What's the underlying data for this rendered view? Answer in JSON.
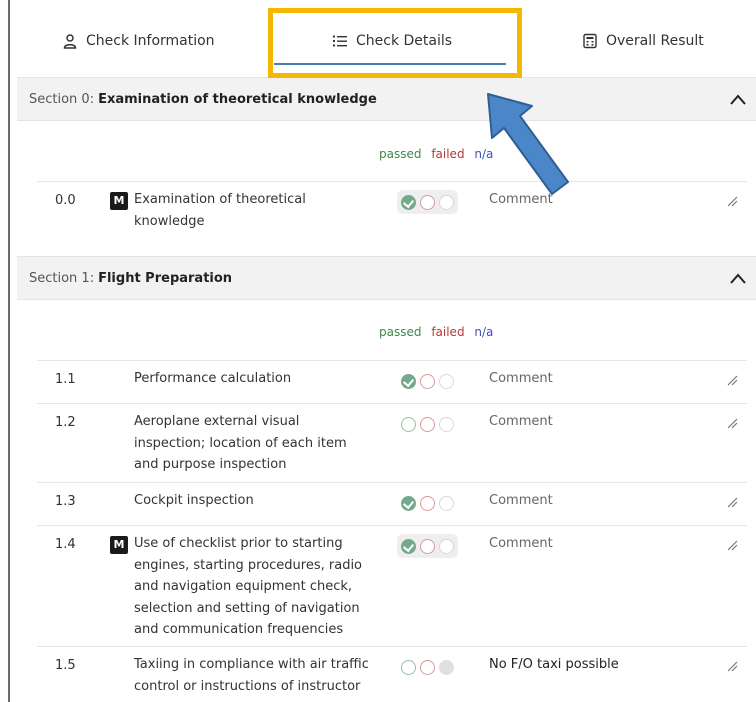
{
  "tabs": [
    {
      "label": "Check Information",
      "icon": "user-icon"
    },
    {
      "label": "Check Details",
      "icon": "list-icon"
    },
    {
      "label": "Overall Result",
      "icon": "calculator-icon"
    }
  ],
  "legend": {
    "passed": "passed",
    "failed": "failed",
    "na": "n/a"
  },
  "colors": {
    "highlight": "#f5b800",
    "arrow": "#4a86c8",
    "passed": "#3a8a4a",
    "failed": "#b53a3a",
    "na": "#3a55b5"
  },
  "sections": [
    {
      "prefix": "Section 0:",
      "title": "Examination of theoretical knowledge",
      "rows": [
        {
          "num": "0.0",
          "mandatory": "M",
          "desc": "Examination of theoretical knowledge",
          "result": "passed",
          "comment": "Comment"
        }
      ]
    },
    {
      "prefix": "Section 1:",
      "title": "Flight Preparation",
      "rows": [
        {
          "num": "1.1",
          "desc": "Performance calculation",
          "result": "passed",
          "comment": "Comment"
        },
        {
          "num": "1.2",
          "desc": "Aeroplane external visual inspection; location of each item and purpose inspection",
          "result": "none",
          "comment": "Comment"
        },
        {
          "num": "1.3",
          "desc": "Cockpit inspection",
          "result": "passed",
          "comment": "Comment"
        },
        {
          "num": "1.4",
          "mandatory": "M",
          "desc": "Use of checklist prior to starting engines, starting procedures, radio and navigation equipment check, selection and setting of navigation and communication frequencies",
          "result": "passed",
          "comment": "Comment"
        },
        {
          "num": "1.5",
          "desc": "Taxiing in compliance with air traffic control or instructions of instructor",
          "result": "na",
          "comment": "No F/O taxi possible"
        }
      ]
    }
  ]
}
